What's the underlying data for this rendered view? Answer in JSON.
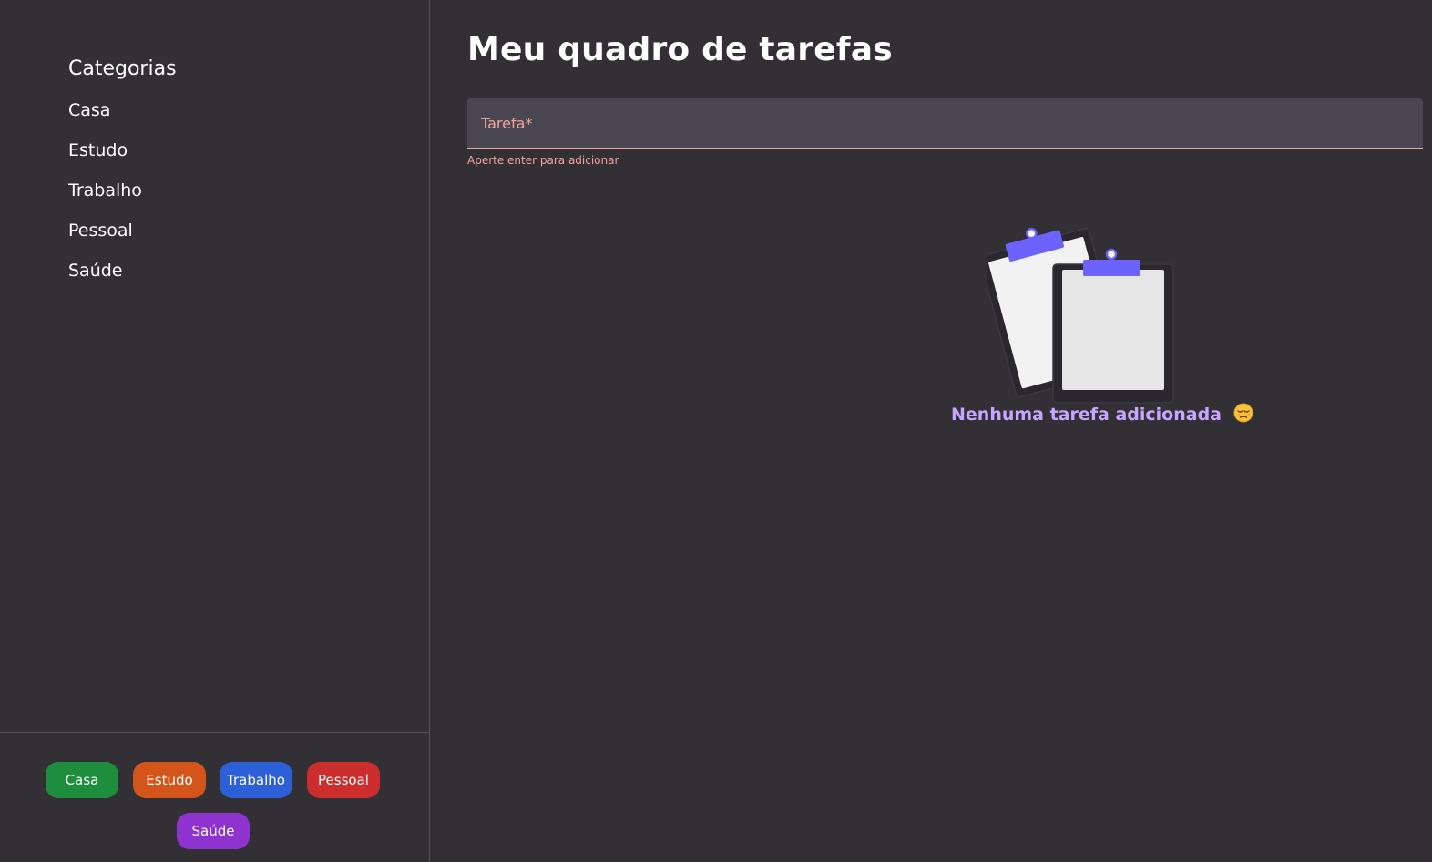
{
  "sidebar": {
    "heading": "Categorias",
    "items": [
      {
        "label": "Casa"
      },
      {
        "label": "Estudo"
      },
      {
        "label": "Trabalho"
      },
      {
        "label": "Pessoal"
      },
      {
        "label": "Saúde"
      }
    ],
    "chips": [
      {
        "label": "Casa",
        "color": "#1e8e3e"
      },
      {
        "label": "Estudo",
        "color": "#d4551a"
      },
      {
        "label": "Trabalho",
        "color": "#2d5fd6"
      },
      {
        "label": "Pessoal",
        "color": "#cc2d2d"
      },
      {
        "label": "Saúde",
        "color": "#8e33d0"
      }
    ]
  },
  "main": {
    "title": "Meu quadro de tarefas",
    "task_input": {
      "placeholder": "Tarefa*",
      "value": "",
      "helper": "Aperte enter para adicionar"
    },
    "empty_state": {
      "message": "Nenhuma tarefa adicionada",
      "illustration": "clipboards-icon",
      "emoji": "pensive-face-icon"
    }
  },
  "colors": {
    "background": "#322f35",
    "input_background": "#4a4652",
    "accent_error": "#f2a69a",
    "empty_text": "#c7a6ff",
    "clip": "#6c63ff"
  }
}
